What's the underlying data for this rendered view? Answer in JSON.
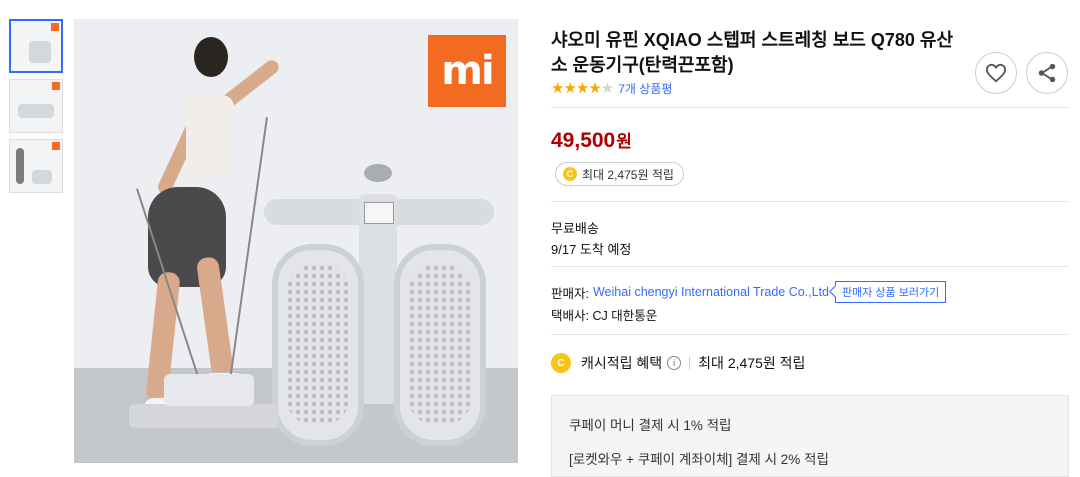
{
  "product": {
    "title": "샤오미 유핀 XQIAO 스텝퍼 스트레칭 보드 Q780 유산소 운동기구(탄력끈포함)",
    "rating_stars": 4,
    "rating_max": 5,
    "rating_count": "7개 상품평",
    "price": "49,500",
    "price_unit": "원",
    "cash_reward": "최대 2,475원 적립",
    "brand_logo": "mi"
  },
  "icons": {
    "favorite": "heart-icon",
    "share": "share-icon",
    "coin": "C",
    "info": "i"
  },
  "shipping": {
    "label": "무료배송",
    "date": "9/17 도착 예정"
  },
  "seller": {
    "label": "판매자:",
    "name": "Weihai chengyi International Trade Co.,Ltd",
    "button": "판매자 상품 보러가기",
    "courier": "택배사: CJ 대한통운"
  },
  "benefit": {
    "title": "캐시적립 혜택",
    "value": "최대 2,475원 적립",
    "lines": [
      "쿠페이 머니 결제 시 1% 적립",
      "[로켓와우 + 쿠페이 계좌이체] 결제 시 2% 적립"
    ]
  },
  "colors": {
    "price": "#ae0000",
    "link": "#346aff",
    "star": "#f7a800",
    "brand": "#f26b21",
    "coin": "#f5c518"
  }
}
